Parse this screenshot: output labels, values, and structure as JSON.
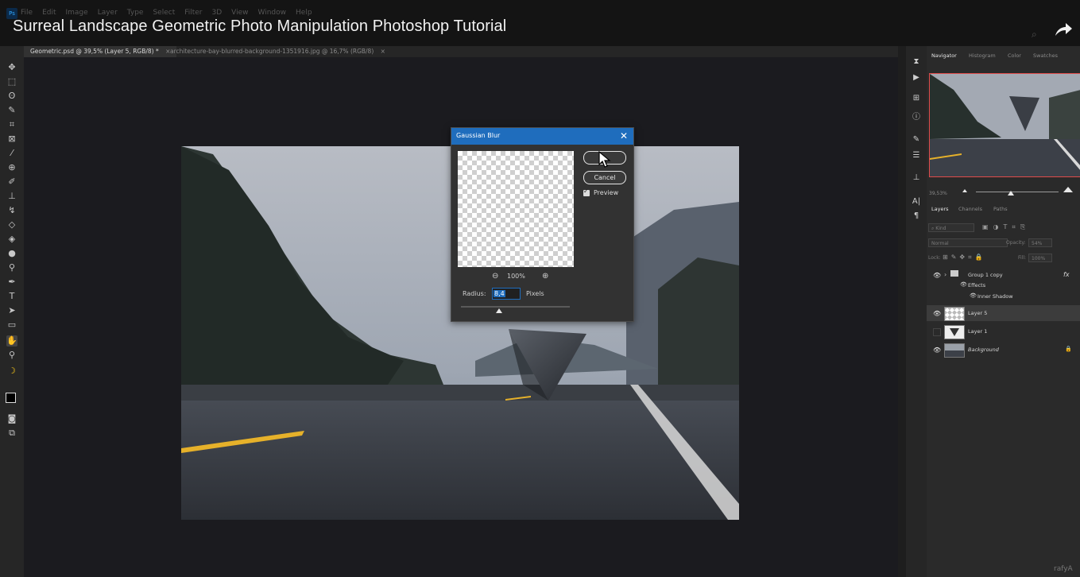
{
  "menu": [
    "File",
    "Edit",
    "Image",
    "Layer",
    "Type",
    "Select",
    "Filter",
    "3D",
    "View",
    "Window",
    "Help"
  ],
  "app_logo": "Ps",
  "video_title": "Surreal Landscape Geometric Photo Manipulation Photoshop Tutorial",
  "tabs": [
    {
      "label": "Geometric.psd @ 39,5% (Layer 5, RGB/8) *",
      "close": "×"
    },
    {
      "label": "architecture-bay-blurred-background-1351916.jpg @ 16,7% (RGB/8)",
      "close": "×"
    }
  ],
  "dialog": {
    "title": "Gaussian Blur",
    "ok_label": "OK",
    "cancel_label": "Cancel",
    "preview_label": "Preview",
    "zoom": "100%",
    "radius_label": "Radius:",
    "radius_value": "8,4",
    "unit_label": "Pixels"
  },
  "panel_tabs": [
    "Navigator",
    "Histogram",
    "Color",
    "Swatches"
  ],
  "navigator_zoom": "39,53%",
  "layers_tabs": [
    "Layers",
    "Channels",
    "Paths"
  ],
  "layers_filter": {
    "kind": "Kind"
  },
  "layers_options": {
    "blend_mode": "Normal",
    "opacity_label": "Opacity:",
    "opacity_value": "54%",
    "lock_label": "Lock:",
    "fill_label": "Fill:",
    "fill_value": "100%"
  },
  "layers": [
    {
      "name": "Group 1 copy",
      "fx": "fx"
    },
    {
      "name": "Effects"
    },
    {
      "name": "Inner Shadow"
    },
    {
      "name": "Layer 5"
    },
    {
      "name": "Layer 1"
    },
    {
      "name": "Background"
    }
  ],
  "watermark": "rafyA"
}
